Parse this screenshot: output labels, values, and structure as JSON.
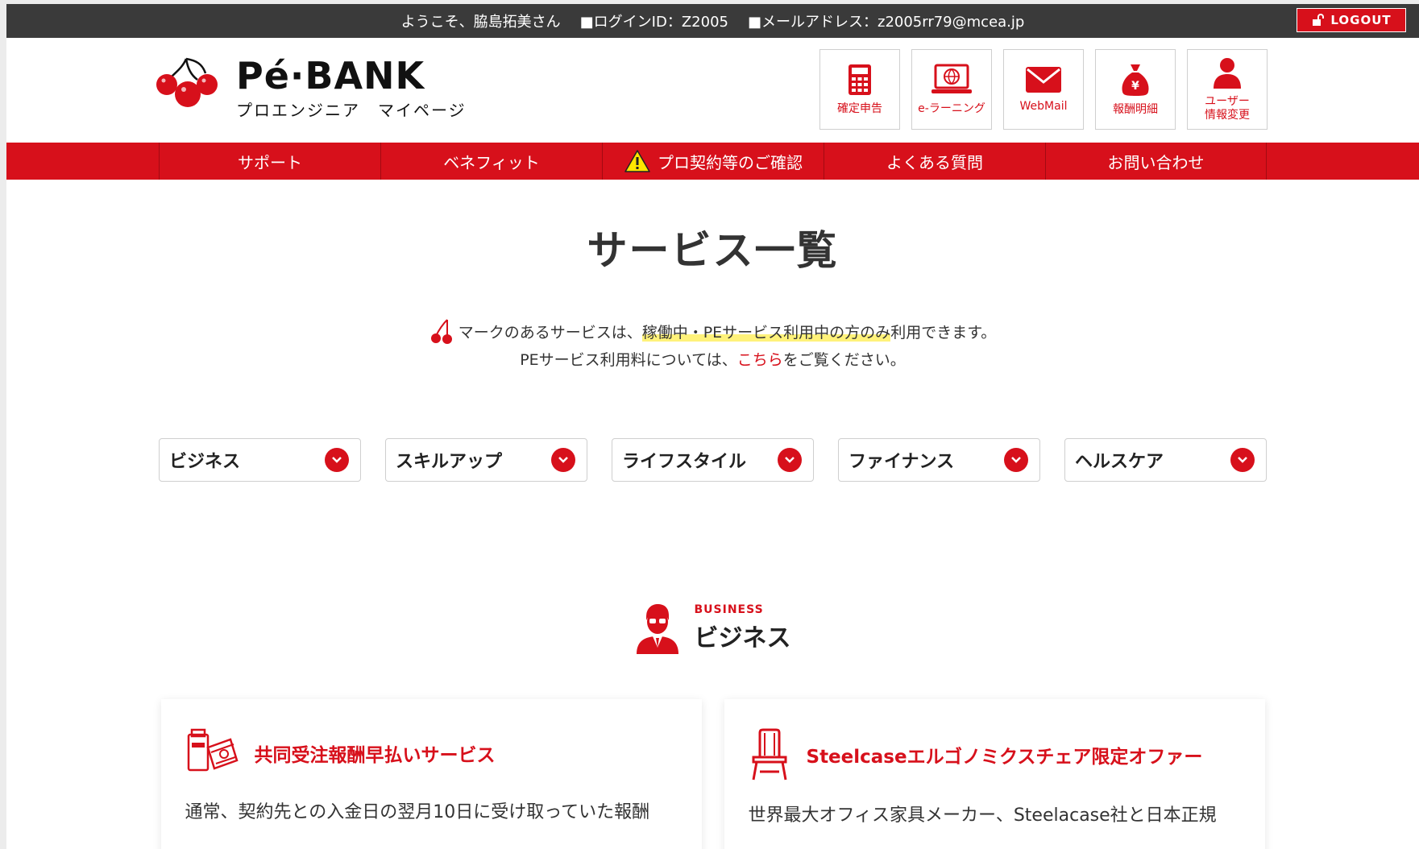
{
  "topbar": {
    "welcome": "ようこそ、脇島拓美さん",
    "login_id": "■ログインID：Z2005",
    "email": "■メールアドレス：z2005rr79@mcea.jp",
    "logout_label": "LOGOUT"
  },
  "logo": {
    "main": "Pé·BANK",
    "sub": "プロエンジニア　マイページ"
  },
  "header_icons": [
    {
      "icon": "calculator-icon",
      "label": "確定申告"
    },
    {
      "icon": "laptop-globe-icon",
      "label": "e-ラーニング"
    },
    {
      "icon": "mail-icon",
      "label": "WebMail"
    },
    {
      "icon": "money-bag-icon",
      "label": "報酬明細"
    },
    {
      "icon": "user-icon",
      "label": "ユーザー\n情報変更"
    }
  ],
  "nav": [
    {
      "label": "サポート"
    },
    {
      "label": "ベネフィット"
    },
    {
      "label": "プロ契約等のご確認",
      "icon": "warning-icon"
    },
    {
      "label": "よくある質問"
    },
    {
      "label": "お問い合わせ"
    }
  ],
  "page": {
    "title": "サービス一覧",
    "notice_pre": "マークのあるサービスは、",
    "notice_highlight": "稼働中・PEサービス利用中の方のみ",
    "notice_post": "利用できます。",
    "notice2_pre": "PEサービス利用料については、",
    "notice2_link": "こちら",
    "notice2_post": "をご覧ください。"
  },
  "categories": [
    "ビジネス",
    "スキルアップ",
    "ライフスタイル",
    "ファイナンス",
    "ヘルスケア"
  ],
  "section": {
    "en": "BUSINESS",
    "jp": "ビジネス"
  },
  "cards": [
    {
      "icon": "payment-document-icon",
      "title": "共同受注報酬早払いサービス",
      "text": "通常、契約先との入金日の翌月10日に受け取っていた報酬"
    },
    {
      "icon": "chair-icon",
      "title": "Steelcaseエルゴノミクスチェア限定オファー",
      "text": "世界最大オフィス家具メーカー、Steelacase社と日本正規"
    }
  ],
  "colors": {
    "brand_red": "#d7101b",
    "topbar_bg": "#3a3a3a",
    "highlight": "#fff27a"
  }
}
